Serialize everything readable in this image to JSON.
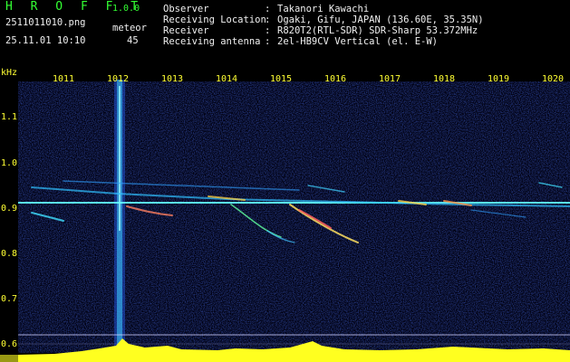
{
  "header": {
    "app_title": "H R O F F T",
    "version": "1.0.0",
    "filename": "2511011010.png",
    "datetime": "25.11.01 10:10",
    "meteor_label": "meteor",
    "meteor_count": "45"
  },
  "meta": [
    {
      "label": "Observer",
      "sep": ":",
      "value": "Takanori Kawachi"
    },
    {
      "label": "Receiving Location",
      "sep": ":",
      "value": "Ogaki, Gifu, JAPAN (136.60E, 35.35N)"
    },
    {
      "label": "Receiver",
      "sep": ":",
      "value": "R820T2(RTL-SDR) SDR-Sharp 53.372MHz"
    },
    {
      "label": "Receiving antenna",
      "sep": ":",
      "value": "2el-HB9CV Vertical (el. E-W)"
    }
  ],
  "spectrogram": {
    "unit_label": "kHz",
    "time_labels": [
      "1011",
      "1012",
      "1013",
      "1014",
      "1015",
      "1016",
      "1017",
      "1018",
      "1019",
      "1020"
    ],
    "freq_labels": [
      "1.1",
      "1.0",
      "0.9",
      "0.8",
      "0.7",
      "0.6"
    ],
    "colors": {
      "text": "#33ff33",
      "axis_labels": "#ffff33",
      "background": "#000000",
      "noise": "#1a2aa0",
      "signal": "#40ffff",
      "bars": "#ffff00"
    }
  }
}
